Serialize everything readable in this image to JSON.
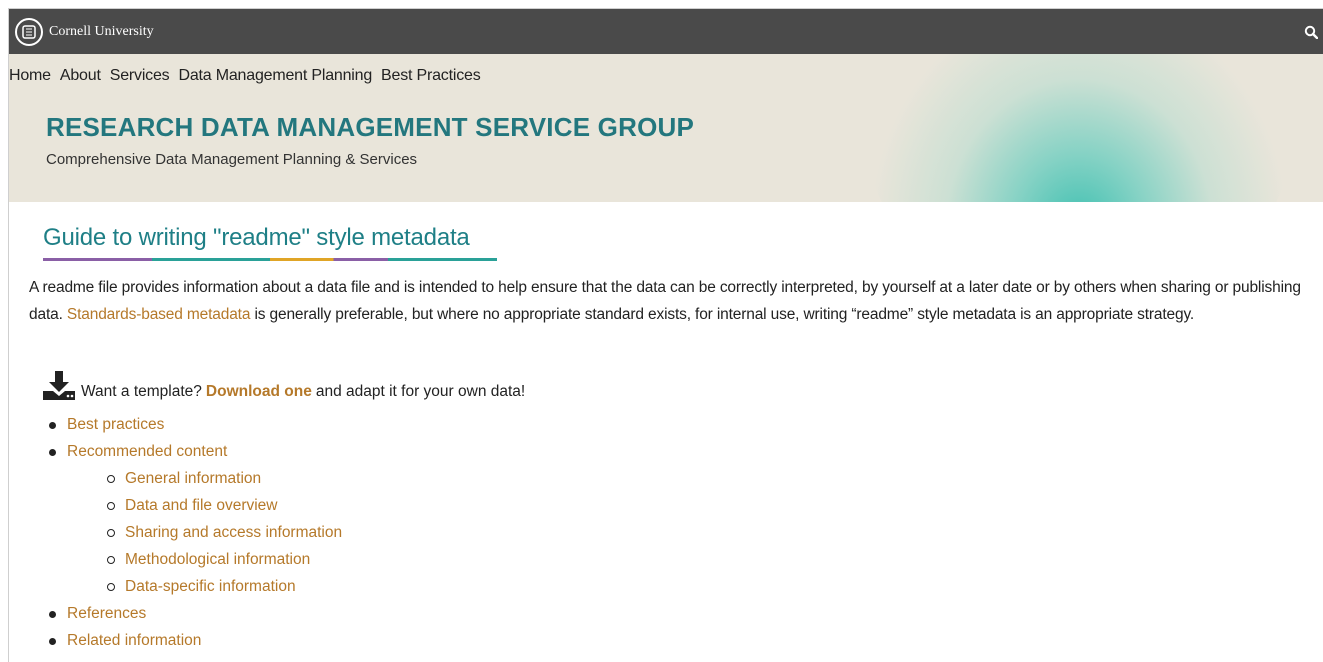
{
  "header": {
    "brand": "Cornell University",
    "icons": {
      "seal": "cornell-seal-icon",
      "search": "search-icon"
    }
  },
  "nav": {
    "items": [
      "Home",
      "About",
      "Services",
      "Data Management Planning",
      "Best Practices"
    ]
  },
  "banner": {
    "title": "RESEARCH DATA MANAGEMENT SERVICE GROUP",
    "subtitle": "Comprehensive Data Management Planning & Services"
  },
  "main": {
    "title": "Guide to writing \"readme\" style metadata",
    "intro_part1": "A readme file provides information about a data file and is intended to help ensure that the data can be correctly interpreted, by yourself at a later date or by others when sharing or publishing data.",
    "intro_link": "Standards-based metadata",
    "intro_part2": "is generally preferable, but where no appropriate standard exists, for internal use, writing “readme” style metadata is an appropriate strategy.",
    "template_prefix": "Want a template?",
    "template_link": "Download one",
    "template_suffix": "and adapt it for your own data!",
    "template_icon": "download-icon",
    "toc": {
      "best_practices": "Best practices",
      "recommended_content": "Recommended content",
      "sub": [
        "General information",
        "Data and file overview",
        "Sharing and access information",
        "Methodological information",
        "Data-specific information"
      ],
      "references": "References",
      "related": "Related information"
    }
  },
  "colors": {
    "link": "#b5792a",
    "title": "#1e7f86",
    "banner_title": "#23777e",
    "topbar": "#4a4a4a",
    "banner_bg": "#e9e5da"
  }
}
